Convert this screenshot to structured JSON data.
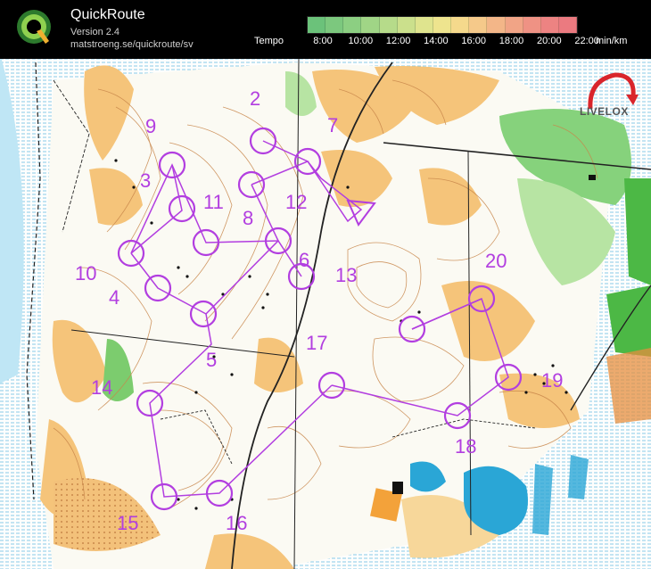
{
  "header": {
    "app_name": "QuickRoute",
    "version": "Version 2.4",
    "url": "matstroeng.se/quickroute/sv",
    "tempo_label": "Tempo",
    "unit": "min/km",
    "scale_ticks": [
      "8:00",
      "10:00",
      "12:00",
      "14:00",
      "16:00",
      "18:00",
      "20:00",
      "22:00"
    ],
    "scale_colors": [
      "#6bc27a",
      "#7cc87e",
      "#8ccf82",
      "#a0d586",
      "#b6db8a",
      "#cbe08c",
      "#dfe48e",
      "#eee48e",
      "#f5d98c",
      "#f5c98a",
      "#f3b688",
      "#f1a486",
      "#ef9284",
      "#ed8382",
      "#eb7a80"
    ]
  },
  "branding": {
    "logo_letter": "Q",
    "livelox": "LIVELOX"
  },
  "map": {
    "controls": [
      {
        "number": "2"
      },
      {
        "number": "3"
      },
      {
        "number": "4"
      },
      {
        "number": "5"
      },
      {
        "number": "6"
      },
      {
        "number": "7"
      },
      {
        "number": "8"
      },
      {
        "number": "9"
      },
      {
        "number": "10"
      },
      {
        "number": "11"
      },
      {
        "number": "12"
      },
      {
        "number": "13"
      },
      {
        "number": "14"
      },
      {
        "number": "15"
      },
      {
        "number": "16"
      },
      {
        "number": "17"
      },
      {
        "number": "18"
      },
      {
        "number": "19"
      },
      {
        "number": "20"
      }
    ],
    "colors": {
      "course": "#b23ee0",
      "contour": "#c8864a",
      "open_land": "#f6c97e",
      "forest_green": "#7fd07a",
      "water": "#2aa6d6",
      "marsh": "#4fb3e0"
    }
  }
}
